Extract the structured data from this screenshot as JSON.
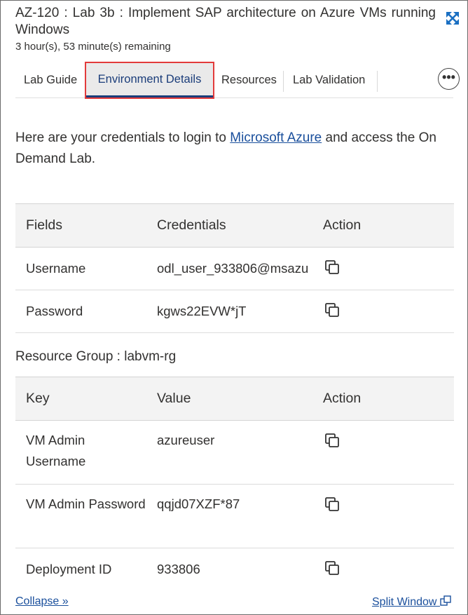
{
  "header": {
    "title": "AZ-120 : Lab 3b : Implement SAP architecture on Azure VMs running Windows",
    "remaining": "3 hour(s), 53 minute(s) remaining",
    "expand_icon": "expand-arrows-icon"
  },
  "tabs": [
    {
      "label": "Lab Guide",
      "active": false
    },
    {
      "label": "Environment Details",
      "active": true
    },
    {
      "label": "Resources",
      "active": false
    },
    {
      "label": "Lab Validation",
      "active": false
    }
  ],
  "more_button": "•••",
  "intro": {
    "prefix": "Here are your credentials to login to ",
    "link": "Microsoft Azure",
    "suffix": " and access the On Demand Lab."
  },
  "credentials_table": {
    "headers": [
      "Fields",
      "Credentials",
      "Action"
    ],
    "rows": [
      {
        "field": "Username",
        "value": "odl_user_933806@msazu"
      },
      {
        "field": "Password",
        "value": "kgws22EVW*jT"
      }
    ]
  },
  "resource_group": {
    "label": "Resource Group : labvm-rg"
  },
  "resource_table": {
    "headers": [
      "Key",
      "Value",
      "Action"
    ],
    "rows": [
      {
        "key": "VM Admin Username",
        "value": "azureuser"
      },
      {
        "key": "VM Admin Password",
        "value": "qqjd07XZF*87"
      },
      {
        "key": "Deployment ID",
        "value": "933806"
      }
    ]
  },
  "footer": {
    "collapse": "Collapse »",
    "split_window": "Split Window"
  },
  "colors": {
    "accent": "#1b3d7a",
    "link": "#1a4f9c",
    "active_tab_outline": "#e23b3b"
  }
}
